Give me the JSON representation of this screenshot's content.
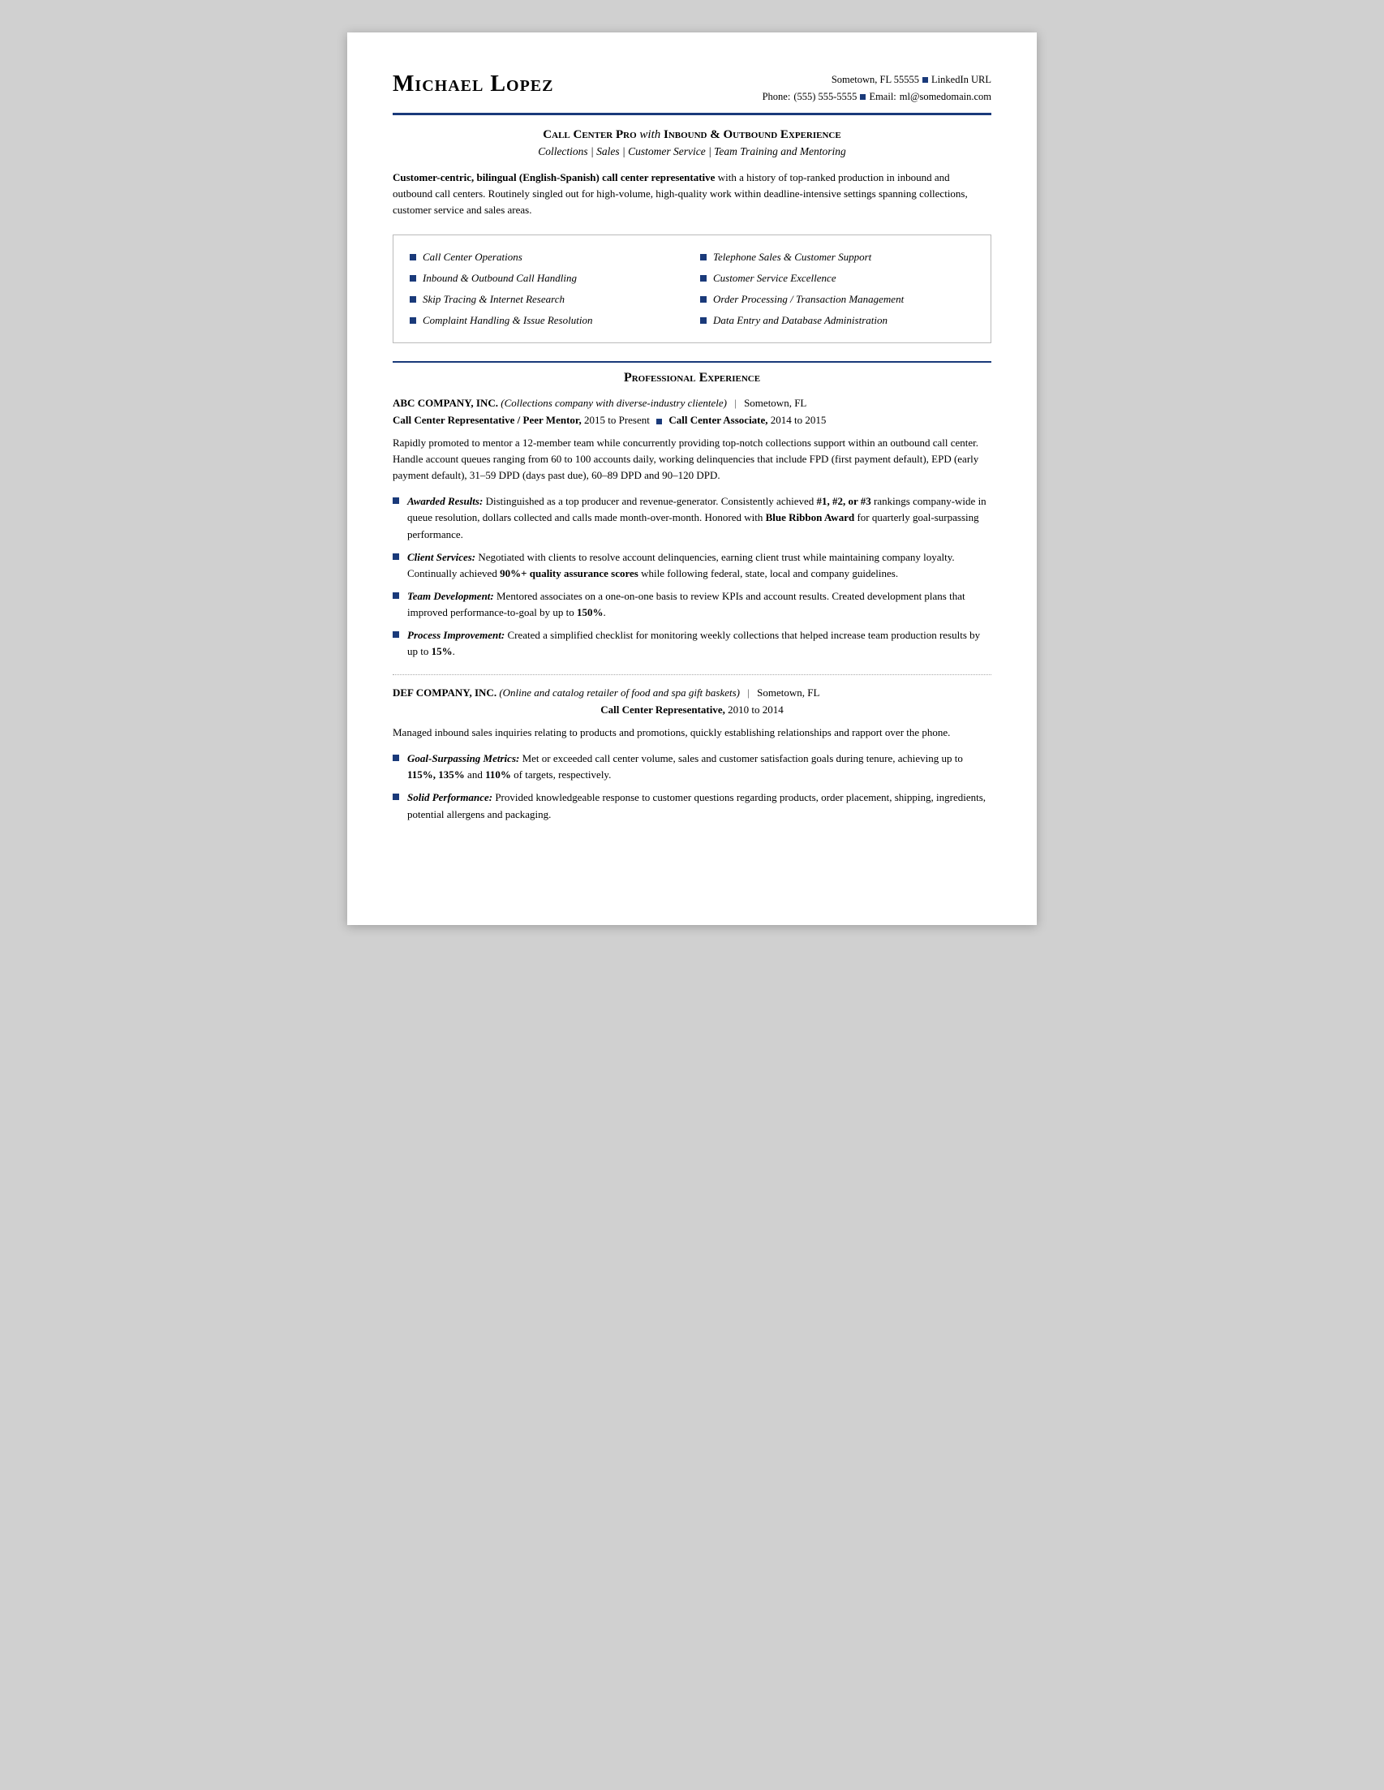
{
  "header": {
    "name": "Michael Lopez",
    "contact": {
      "line1_city": "Sometown, FL 55555",
      "line1_linkedin": "LinkedIn URL",
      "line2_phone_label": "Phone:",
      "line2_phone": "(555) 555-5555",
      "line2_email_label": "Email:",
      "line2_email": "ml@somedomain.com"
    }
  },
  "title": {
    "main": "Call Center Pro",
    "italic_connector": "with",
    "bold_rest": "Inbound & Outbound Experience",
    "subtitle": "Collections | Sales | Customer Service | Team Training and Mentoring"
  },
  "summary": {
    "bold_part": "Customer-centric, bilingual (English-Spanish) call center representative",
    "rest": " with a history of top-ranked production in inbound and outbound call centers. Routinely singled out for high-volume, high-quality work within deadline-intensive settings spanning collections, customer service and sales areas."
  },
  "skills": [
    "Call Center Operations",
    "Telephone Sales & Customer Support",
    "Inbound & Outbound Call Handling",
    "Customer Service Excellence",
    "Skip Tracing & Internet Research",
    "Order Processing / Transaction Management",
    "Complaint Handling & Issue Resolution",
    "Data Entry and Database Administration"
  ],
  "professional_experience_title": "Professional Experience",
  "companies": [
    {
      "name": "ABC COMPANY, INC.",
      "description": "(Collections company with diverse-industry clientele)",
      "location": "Sometown, FL",
      "job_title_line": "Call Center Representative / Peer Mentor, 2015 to Present",
      "job_title_line2": "Call Center Associate, 2014 to 2015",
      "description_body": "Rapidly promoted to mentor a 12-member team while concurrently providing top-notch collections support within an outbound call center. Handle account queues ranging from 60 to 100 accounts daily, working delinquencies that include FPD (first payment default), EPD (early payment default), 31–59 DPD (days past due), 60–89 DPD and 90–120 DPD.",
      "bullets": [
        {
          "label": "Awarded Results:",
          "text": "Distinguished as a top producer and revenue-generator. Consistently achieved #1, #2, or #3 rankings company-wide in queue resolution, dollars collected and calls made month-over-month. Honored with Blue Ribbon Award for quarterly goal-surpassing performance.",
          "bold_phrases": [
            "#1, #2, or #3",
            "Blue Ribbon Award"
          ]
        },
        {
          "label": "Client Services:",
          "text": "Negotiated with clients to resolve account delinquencies, earning client trust while maintaining company loyalty. Continually achieved 90%+ quality assurance scores while following federal, state, local and company guidelines.",
          "bold_phrases": [
            "90%+ quality assurance scores"
          ]
        },
        {
          "label": "Team Development:",
          "text": "Mentored associates on a one-on-one basis to review KPIs and account results. Created development plans that improved performance-to-goal by up to 150%.",
          "bold_phrases": [
            "150%"
          ]
        },
        {
          "label": "Process Improvement:",
          "text": "Created a simplified checklist for monitoring weekly collections that helped increase team production results by up to 15%.",
          "bold_phrases": [
            "15%"
          ]
        }
      ]
    },
    {
      "name": "DEF COMPANY, INC.",
      "description": "(Online and catalog retailer of food and spa gift baskets)",
      "location": "Sometown, FL",
      "job_title_line": "Call Center Representative, 2010 to 2014",
      "job_title_line2": null,
      "description_body": "Managed inbound sales inquiries relating to products and promotions, quickly establishing relationships and rapport over the phone.",
      "bullets": [
        {
          "label": "Goal-Surpassing Metrics:",
          "text": "Met or exceeded call center volume, sales and customer satisfaction goals during tenure, achieving up to 115%, 135% and 110% of targets, respectively.",
          "bold_phrases": [
            "115%, 135%",
            "110%"
          ]
        },
        {
          "label": "Solid Performance:",
          "text": "Provided knowledgeable response to customer questions regarding products, order placement, shipping, ingredients, potential allergens and packaging.",
          "bold_phrases": []
        }
      ]
    }
  ]
}
